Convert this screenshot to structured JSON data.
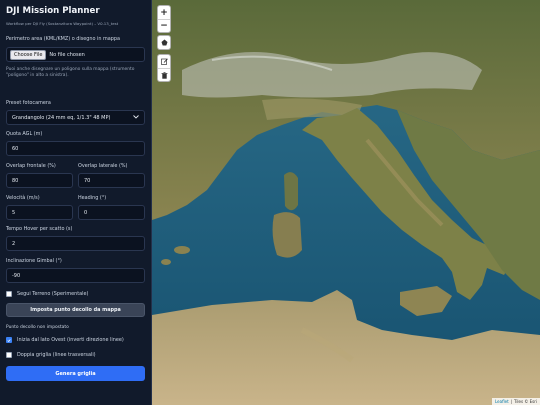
{
  "app": {
    "title": "DJI Mission Planner",
    "subtitle": "Workflow per DJI Fly (Sostanzitura Waypoint) – V0.13_test"
  },
  "form": {
    "area_label": "Perimetro area (KML/KMZ) o disegno in mappa",
    "file_button": "Choose File",
    "file_status": "No file chosen",
    "draw_hint": "Puoi anche disegnare un poligono sulla mappa (strumento \"poligono\" in alto a sinistra).",
    "camera_label": "Preset fotocamera",
    "camera_value": "Grandangolo (24 mm eq, 1/1.3\" 48 MP)",
    "altitude_label": "Quota AGL (m)",
    "altitude_value": "60",
    "overlap_front_label": "Overlap frontale (%)",
    "overlap_front_value": "80",
    "overlap_side_label": "Overlap laterale (%)",
    "overlap_side_value": "70",
    "speed_label": "Velocità (m/s)",
    "speed_value": "5",
    "heading_label": "Heading (°)",
    "heading_value": "0",
    "hover_label": "Tempo Hover per scatto (s)",
    "hover_value": "2",
    "gimbal_label": "Inclinazione Gimbal (°)",
    "gimbal_value": "-90",
    "terrain_label": "Segui Terreno (Sperimentale)",
    "terrain_checked": false,
    "takeoff_button": "Imposta punto decollo da mappa",
    "takeoff_status": "Punto decollo non impostato",
    "west_start_label": "Inizia dal lato Ovest (inverti direzione linee)",
    "west_start_checked": true,
    "double_grid_label": "Doppia griglia (linee trasversali)",
    "double_grid_checked": false,
    "generate_button": "Genera griglia"
  },
  "map": {
    "zoom_in": "+",
    "zoom_out": "−",
    "tools": [
      "polygon-icon",
      "edit-icon",
      "trash-icon"
    ],
    "attribution_leaflet": "Leaflet",
    "attribution_tiles": "Tiles © Esri"
  },
  "colors": {
    "sidebar_bg": "#111a2b",
    "accent": "#2f6df5",
    "sea": "#1f5a78"
  }
}
